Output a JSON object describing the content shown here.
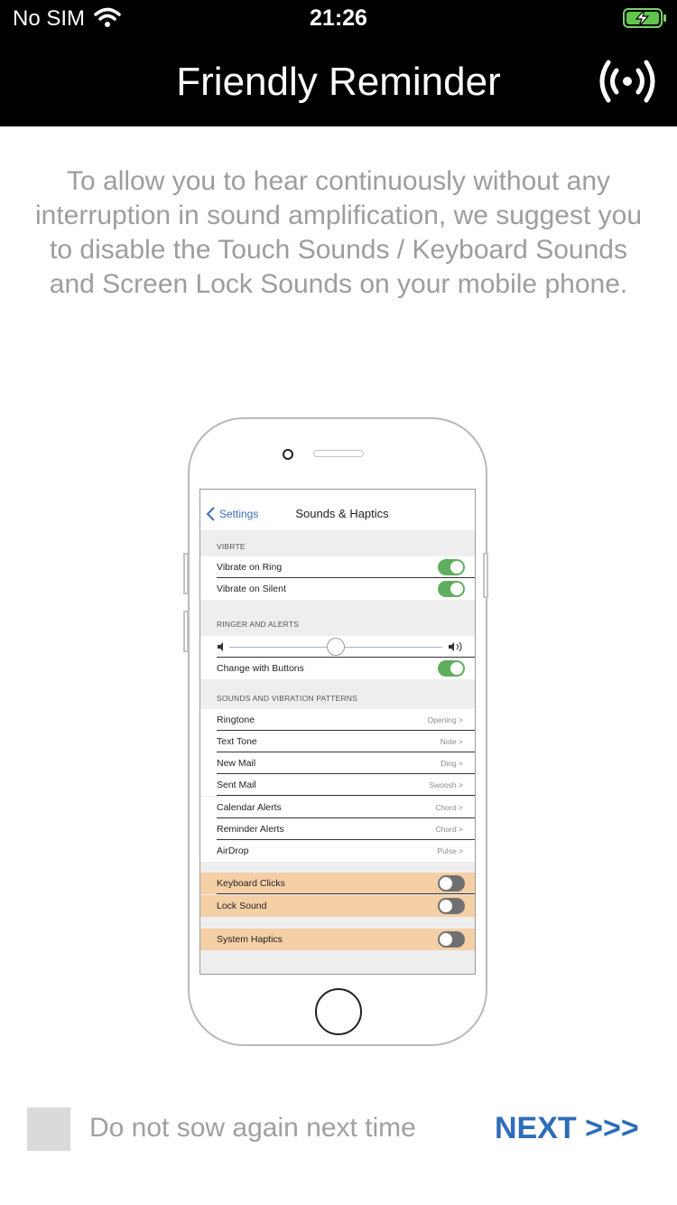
{
  "status_bar": {
    "carrier": "No SIM",
    "time": "21:26"
  },
  "header": {
    "title": "Friendly Reminder"
  },
  "intro": "To allow you to hear continuously without any interruption in sound amplification, we suggest you to disable the Touch Sounds / Keyboard Sounds and Screen Lock Sounds on your mobile phone.",
  "illustration": {
    "nav": {
      "back_label": "Settings",
      "title": "Sounds & Haptics"
    },
    "vibrate_section": "VIBRTE",
    "vibrate_rows": [
      {
        "label": "Vibrate on Ring",
        "toggle": "on"
      },
      {
        "label": "Vibrate on Silent",
        "toggle": "on"
      }
    ],
    "ringer_section": "RINGER AND ALERTS",
    "ringer_volume": 0.5,
    "change_with_buttons": {
      "label": "Change with Buttons",
      "toggle": "on"
    },
    "patterns_section": "SOUNDS AND VIBRATION PATTERNS",
    "patterns": [
      {
        "label": "Ringtone",
        "value": "Opening >"
      },
      {
        "label": "Text Tone",
        "value": "Note >"
      },
      {
        "label": "New Mail",
        "value": "Ding >"
      },
      {
        "label": "Sent Mail",
        "value": "Swoosh >"
      },
      {
        "label": "Calendar Alerts",
        "value": "Chord >"
      },
      {
        "label": "Reminder Alerts",
        "value": "Chord >"
      },
      {
        "label": "AirDrop",
        "value": "Pulse >"
      }
    ],
    "highlighted": [
      {
        "label": "Keyboard Clicks",
        "toggle": "off"
      },
      {
        "label": "Lock Sound",
        "toggle": "off"
      },
      {
        "label": "System Haptics",
        "toggle": "off"
      }
    ],
    "colors": {
      "toggle_on": "#5fae5f",
      "toggle_off": "#707070",
      "highlight": "#f5cfa6",
      "link": "#3a6fb5"
    }
  },
  "footer": {
    "checkbox_label": "Do not sow again next time",
    "checkbox_checked": false,
    "next_label": "NEXT >>>"
  },
  "colors": {
    "header_bg": "#000000",
    "next": "#2f6db8",
    "intro_text": "#9d9d9d"
  }
}
